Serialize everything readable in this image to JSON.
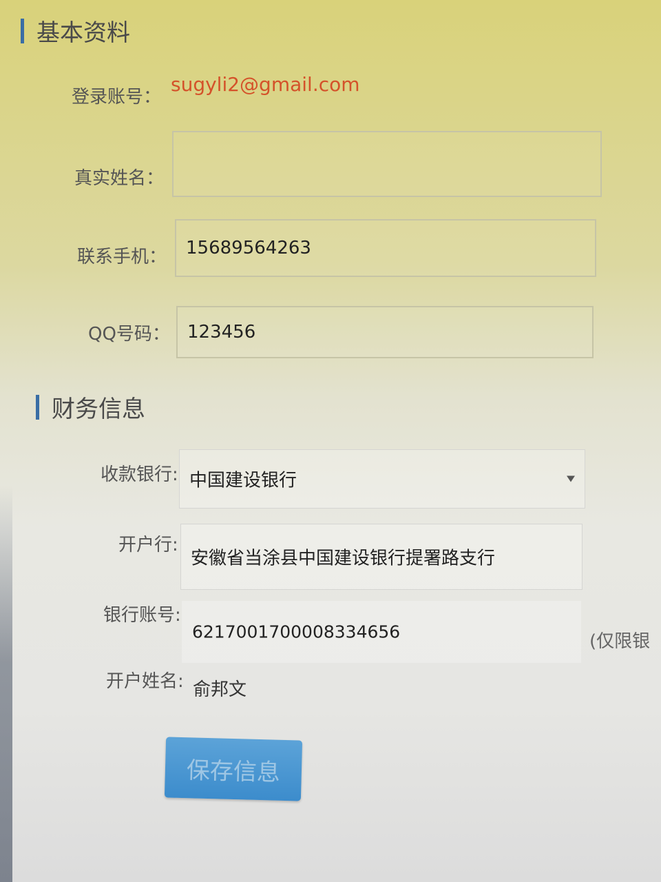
{
  "sections": {
    "basic_title": "基本资料",
    "finance_title": "财务信息"
  },
  "basic": {
    "account_label": "登录账号：",
    "account_value": "sugyli2@gmail.com",
    "realname_label": "真实姓名：",
    "realname_value": "",
    "phone_label": "联系手机：",
    "phone_value": "15689564263",
    "qq_label": "QQ号码：",
    "qq_value": "123456"
  },
  "finance": {
    "bank_label": "收款银行:",
    "bank_value": "中国建设银行",
    "branch_label": "开户行:",
    "branch_value": "安徽省当涂县中国建设银行提署路支行",
    "account_no_label": "银行账号:",
    "account_no_value": "6217001700008334656",
    "account_note": "(仅限银",
    "holder_label": "开户姓名:",
    "holder_value": "俞邦文"
  },
  "actions": {
    "save_label": "保存信息"
  },
  "colors": {
    "accent_bar": "#3a6ea5",
    "email": "#d4522a",
    "button": "#3c8ccc"
  }
}
